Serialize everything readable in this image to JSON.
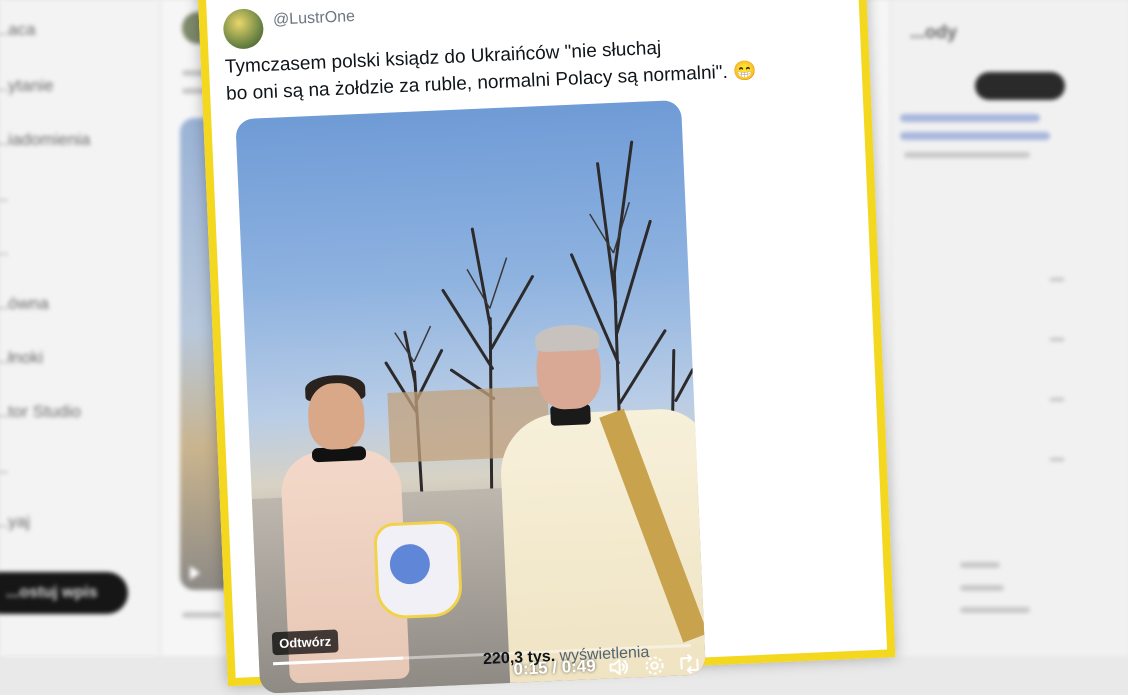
{
  "background": {
    "nav_items": [
      "...aca",
      "...ytanie",
      "...iadomienia",
      "...",
      "...",
      "...ówna",
      "...łnoki",
      "...tor Studio",
      "...",
      "...yaj"
    ],
    "post_button_label": "...ostuj wpis",
    "right_title": "...ody"
  },
  "tweet": {
    "handle": "@LustrOne",
    "text": "Tymczasem polski ksiądz do Ukraińców \"nie słuchaj... bo oni są na żołdzie za ruble, normalni Polacy są normalni\". 😁",
    "text_line1": "Tymczasem polski ksiądz do Ukraińców \"nie słuchaj",
    "text_line2": "bo oni są na żołdzie za ruble, normalni Polacy są normalni\". 😁",
    "views_count": "220,3 tys.",
    "views_label": "wyświetlenia"
  },
  "video": {
    "overlay_label": "Odtwórz",
    "time": "0:15 / 0:49",
    "progress": 0.31,
    "controls": [
      "volume-icon",
      "settings-icon",
      "retweet-icon",
      "fullscreen-icon"
    ]
  },
  "colors": {
    "highlight_border": "#f4d71f",
    "text_primary": "#0f1419",
    "text_secondary": "#536471"
  }
}
